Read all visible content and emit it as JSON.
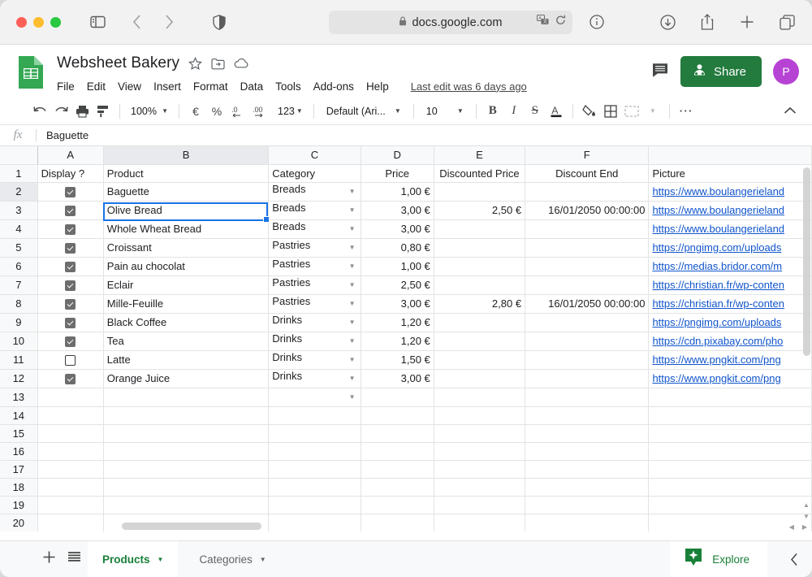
{
  "browser": {
    "url": "docs.google.com",
    "lock_icon": "lock-icon",
    "icons": {
      "sidebar": "sidebar-toggle-icon",
      "back": "back-arrow-icon",
      "forward": "forward-arrow-icon",
      "shield": "privacy-shield-icon",
      "translate": "translate-icon",
      "reload": "reload-icon",
      "info": "info-icon",
      "download": "download-icon",
      "share": "share-icon",
      "new_tab": "plus-icon",
      "tabs": "tab-overview-icon"
    }
  },
  "header": {
    "doc_title": "Websheet Bakery",
    "star_icon": "star-icon",
    "move_icon": "move-to-folder-icon",
    "cloud_icon": "cloud-saved-icon",
    "menus": [
      "File",
      "Edit",
      "View",
      "Insert",
      "Format",
      "Data",
      "Tools",
      "Add-ons",
      "Help"
    ],
    "last_edit": "Last edit was 6 days ago",
    "comment_icon": "comment-icon",
    "share_label": "Share",
    "share_icon": "share-person-icon",
    "avatar_initial": "P",
    "accent_green": "#237b3e",
    "avatar_color": "#b743d4"
  },
  "toolbar": {
    "undo": "undo-icon",
    "redo": "redo-icon",
    "print": "print-icon",
    "paint": "paint-format-icon",
    "zoom_value": "100%",
    "currency": "€",
    "percent": "%",
    "dec_decrease": ".0",
    "dec_increase": ".00",
    "more_formats": "123",
    "font_name": "Default (Ari...",
    "font_size": "10",
    "bold": "B",
    "italic": "I",
    "strikethrough": "S",
    "text_color": "A",
    "fill_color": "fill-color-icon",
    "borders": "borders-icon",
    "merge": "merge-cells-icon",
    "more": "more-options-icon",
    "collapse": "collapse-toolbar-icon"
  },
  "formula_bar": {
    "fx_label": "fx",
    "value": "Baguette"
  },
  "grid": {
    "columns": [
      "A",
      "B",
      "C",
      "D",
      "E",
      "F",
      ""
    ],
    "selected_column": "B",
    "selected_row": "2",
    "row_numbers": [
      "1",
      "2",
      "3",
      "4",
      "5",
      "6",
      "7",
      "8",
      "9",
      "10",
      "11",
      "12",
      "13",
      "14",
      "15",
      "16",
      "17",
      "18",
      "19",
      "20"
    ],
    "headers": [
      "Display ?",
      "Product",
      "Category",
      "Price",
      "Discounted Price",
      "Discount End",
      "Picture"
    ],
    "rows": [
      {
        "display": true,
        "product": "Baguette",
        "category": "Breads",
        "price": "1,00 €",
        "discounted": "",
        "discount_end": "",
        "picture": "https://www.boulangerieland"
      },
      {
        "display": true,
        "product": "Olive Bread",
        "category": "Breads",
        "price": "3,00 €",
        "discounted": "2,50 €",
        "discount_end": "16/01/2050 00:00:00",
        "picture": "https://www.boulangerieland"
      },
      {
        "display": true,
        "product": "Whole Wheat Bread",
        "category": "Breads",
        "price": "3,00 €",
        "discounted": "",
        "discount_end": "",
        "picture": "https://www.boulangerieland"
      },
      {
        "display": true,
        "product": "Croissant",
        "category": "Pastries",
        "price": "0,80 €",
        "discounted": "",
        "discount_end": "",
        "picture": "https://pngimg.com/uploads"
      },
      {
        "display": true,
        "product": "Pain au chocolat",
        "category": "Pastries",
        "price": "1,00 €",
        "discounted": "",
        "discount_end": "",
        "picture": "https://medias.bridor.com/m"
      },
      {
        "display": true,
        "product": "Eclair",
        "category": "Pastries",
        "price": "2,50 €",
        "discounted": "",
        "discount_end": "",
        "picture": "https://christian.fr/wp-conten"
      },
      {
        "display": true,
        "product": "Mille-Feuille",
        "category": "Pastries",
        "price": "3,00 €",
        "discounted": "2,80 €",
        "discount_end": "16/01/2050 00:00:00",
        "picture": "https://christian.fr/wp-conten"
      },
      {
        "display": true,
        "product": "Black Coffee",
        "category": "Drinks",
        "price": "1,20 €",
        "discounted": "",
        "discount_end": "",
        "picture": "https://pngimg.com/uploads"
      },
      {
        "display": true,
        "product": "Tea",
        "category": "Drinks",
        "price": "1,20 €",
        "discounted": "",
        "discount_end": "",
        "picture": "https://cdn.pixabay.com/pho"
      },
      {
        "display": false,
        "product": "Latte",
        "category": "Drinks",
        "price": "1,50 €",
        "discounted": "",
        "discount_end": "",
        "picture": "https://www.pngkit.com/png"
      },
      {
        "display": true,
        "product": "Orange Juice",
        "category": "Drinks",
        "price": "3,00 €",
        "discounted": "",
        "discount_end": "",
        "picture": "https://www.pngkit.com/png"
      }
    ],
    "selection_color": "#1a73e8",
    "link_color": "#1155cc"
  },
  "bottom": {
    "add_sheet_icon": "add-sheet-icon",
    "all_sheets_icon": "all-sheets-icon",
    "tabs": [
      {
        "label": "Products",
        "active": true
      },
      {
        "label": "Categories",
        "active": false
      }
    ],
    "explore_label": "Explore",
    "explore_icon": "explore-icon",
    "collapse_icon": "collapse-icon"
  }
}
